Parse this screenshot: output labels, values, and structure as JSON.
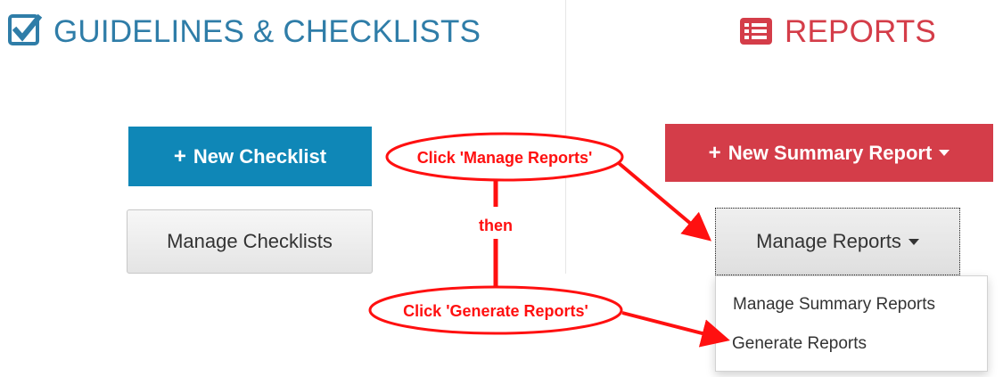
{
  "sections": {
    "guidelines": {
      "title": "GUIDELINES & CHECKLISTS",
      "icon": "checkbox-icon",
      "color": "#2f7da8"
    },
    "reports": {
      "title": "REPORTS",
      "icon": "report-list-icon",
      "color": "#d43d49"
    }
  },
  "buttons": {
    "new_checklist": {
      "label": "New Checklist",
      "icon": "plus-icon",
      "color": "#0f87b7"
    },
    "manage_checklists": {
      "label": "Manage Checklists"
    },
    "new_summary_report": {
      "label": "New Summary Report",
      "icon": "plus-icon",
      "dropdown_icon": "caret-down-icon",
      "color": "#d43d49"
    },
    "manage_reports": {
      "label": "Manage Reports",
      "dropdown_icon": "caret-down-icon"
    }
  },
  "dropdown": {
    "items": [
      "Manage Summary Reports",
      "Generate Reports"
    ]
  },
  "annotations": {
    "manage_reports_callout": "Click 'Manage Reports'",
    "then_text": "then",
    "generate_reports_callout": "Click 'Generate Reports'",
    "color": "#ff1010"
  }
}
